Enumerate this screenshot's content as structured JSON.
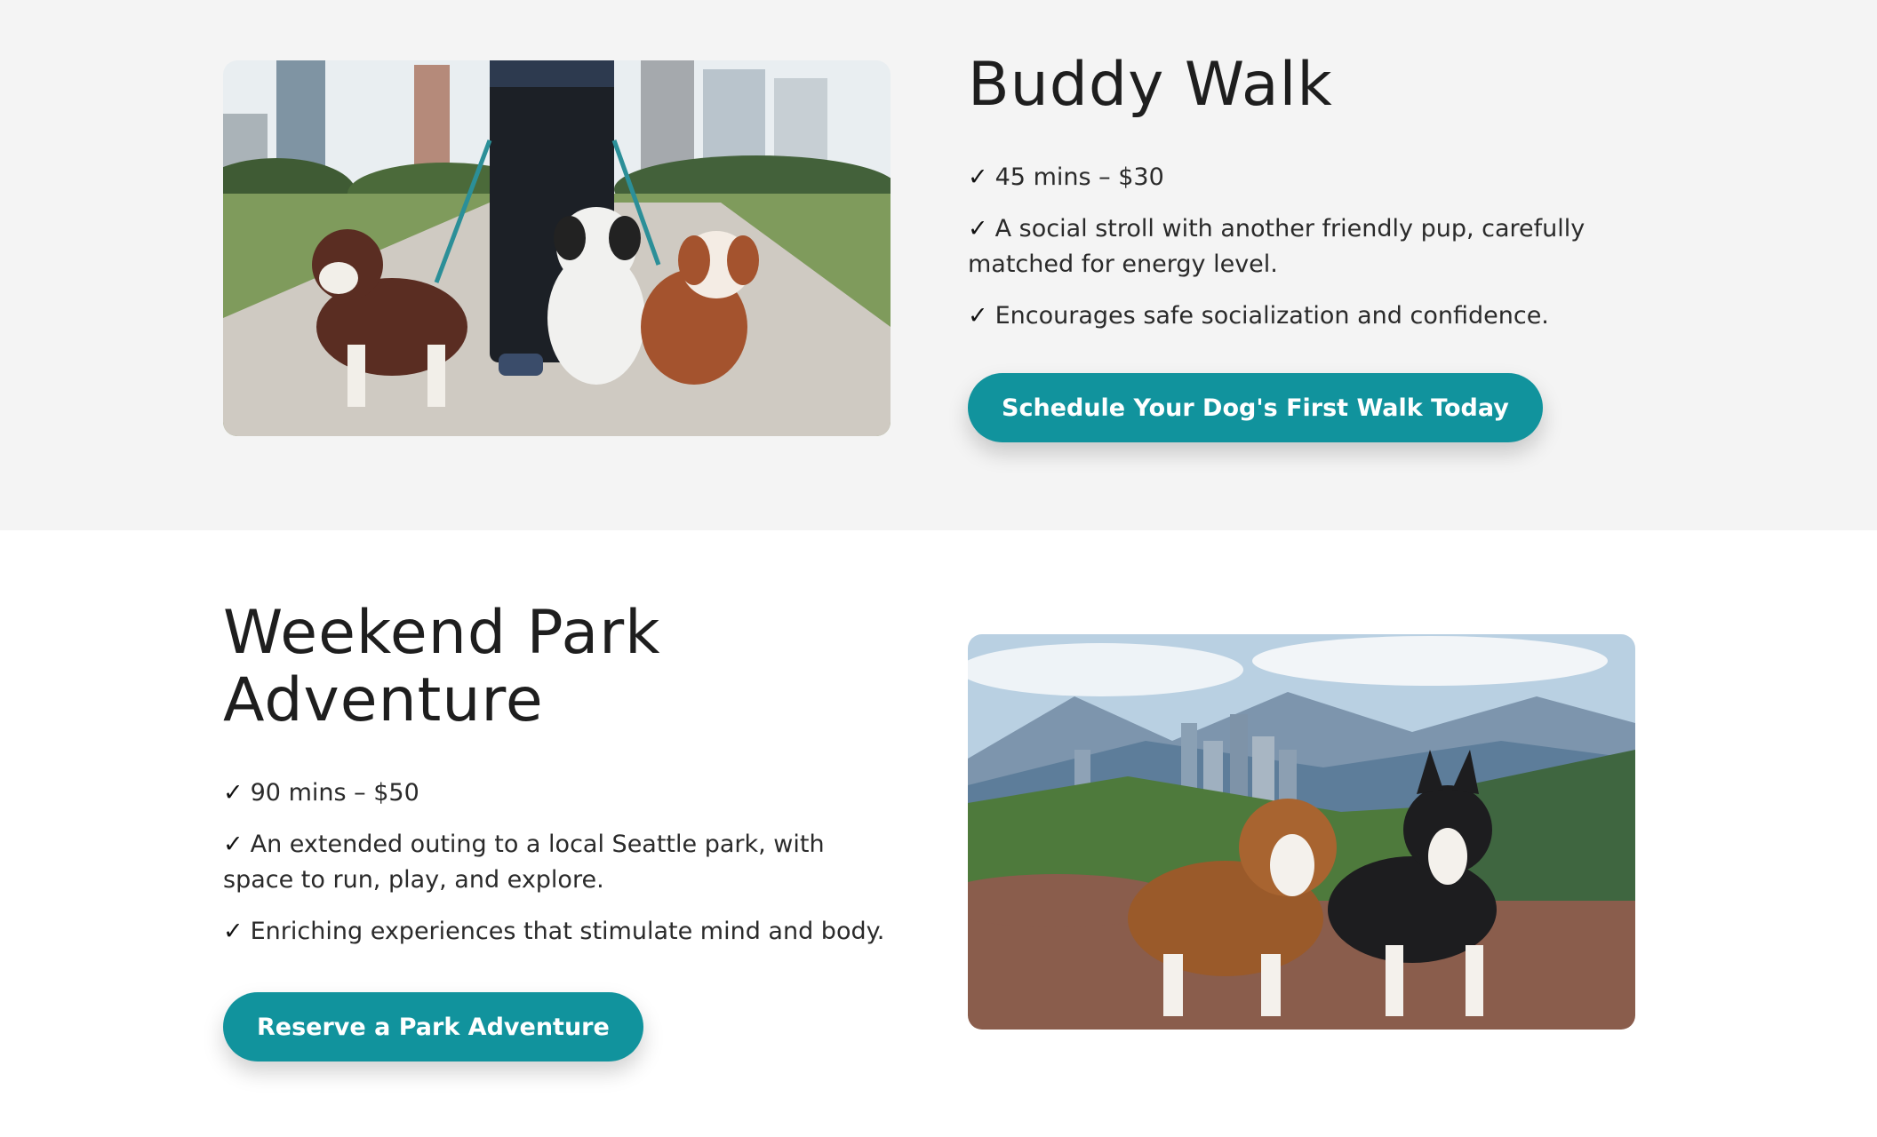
{
  "buddy_walk": {
    "title": "Buddy Walk",
    "features": [
      "45 mins – $30",
      "A social stroll with another friendly pup, carefully matched for energy level.",
      "Encourages safe socialization and confidence."
    ],
    "cta_label": "Schedule Your Dog's First Walk Today"
  },
  "park_adventure": {
    "title_line1": "Weekend Park",
    "title_line2": "Adventure",
    "features": [
      "90 mins – $50",
      "An extended outing to a local Seattle park, with space to run, play, and explore.",
      "Enriching experiences that stimulate mind and body."
    ],
    "cta_label": "Reserve a Park Adventure"
  },
  "check_symbol": "✓",
  "colors": {
    "accent": "#11939d",
    "section_gray": "#f4f4f4",
    "section_white": "#ffffff"
  }
}
